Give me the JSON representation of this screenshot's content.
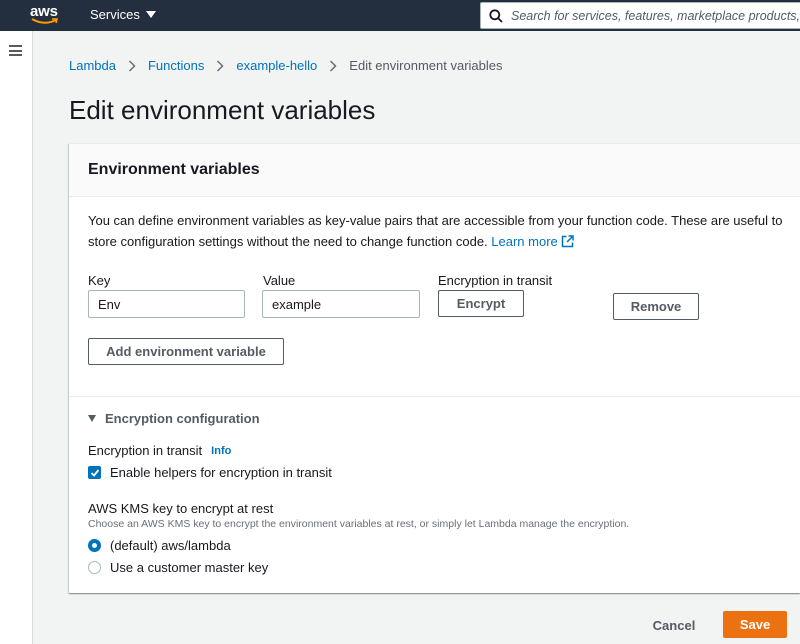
{
  "topnav": {
    "logo_text": "aws",
    "services_label": "Services",
    "search_placeholder": "Search for services, features, marketplace products, and docs"
  },
  "breadcrumb": {
    "items": [
      "Lambda",
      "Functions",
      "example-hello"
    ],
    "current": "Edit environment variables"
  },
  "page": {
    "title": "Edit environment variables"
  },
  "env_section": {
    "title": "Environment variables",
    "description": "You can define environment variables as key-value pairs that are accessible from your function code. These are useful to store configuration settings without the need to change function code.",
    "learn_more": "Learn more",
    "key_label": "Key",
    "value_label": "Value",
    "encryption_label": "Encryption in transit",
    "key_value": "Env",
    "value_value": "example",
    "encrypt_button": "Encrypt",
    "remove_button": "Remove",
    "add_button": "Add environment variable"
  },
  "encryption_config": {
    "title": "Encryption configuration",
    "transit_label": "Encryption in transit",
    "info_link": "Info",
    "helpers_checkbox": "Enable helpers for encryption in transit",
    "helpers_checked": true,
    "kms_label": "AWS KMS key to encrypt at rest",
    "kms_hint": "Choose an AWS KMS key to encrypt the environment variables at rest, or simply let Lambda manage the encryption.",
    "options": [
      "(default) aws/lambda",
      "Use a customer master key"
    ],
    "selected_option": "(default) aws/lambda"
  },
  "footer": {
    "cancel": "Cancel",
    "save": "Save"
  },
  "colors": {
    "nav_bg": "#232f3e",
    "link": "#0073bb",
    "primary": "#ec7211",
    "page_bg": "#f2f3f3"
  }
}
